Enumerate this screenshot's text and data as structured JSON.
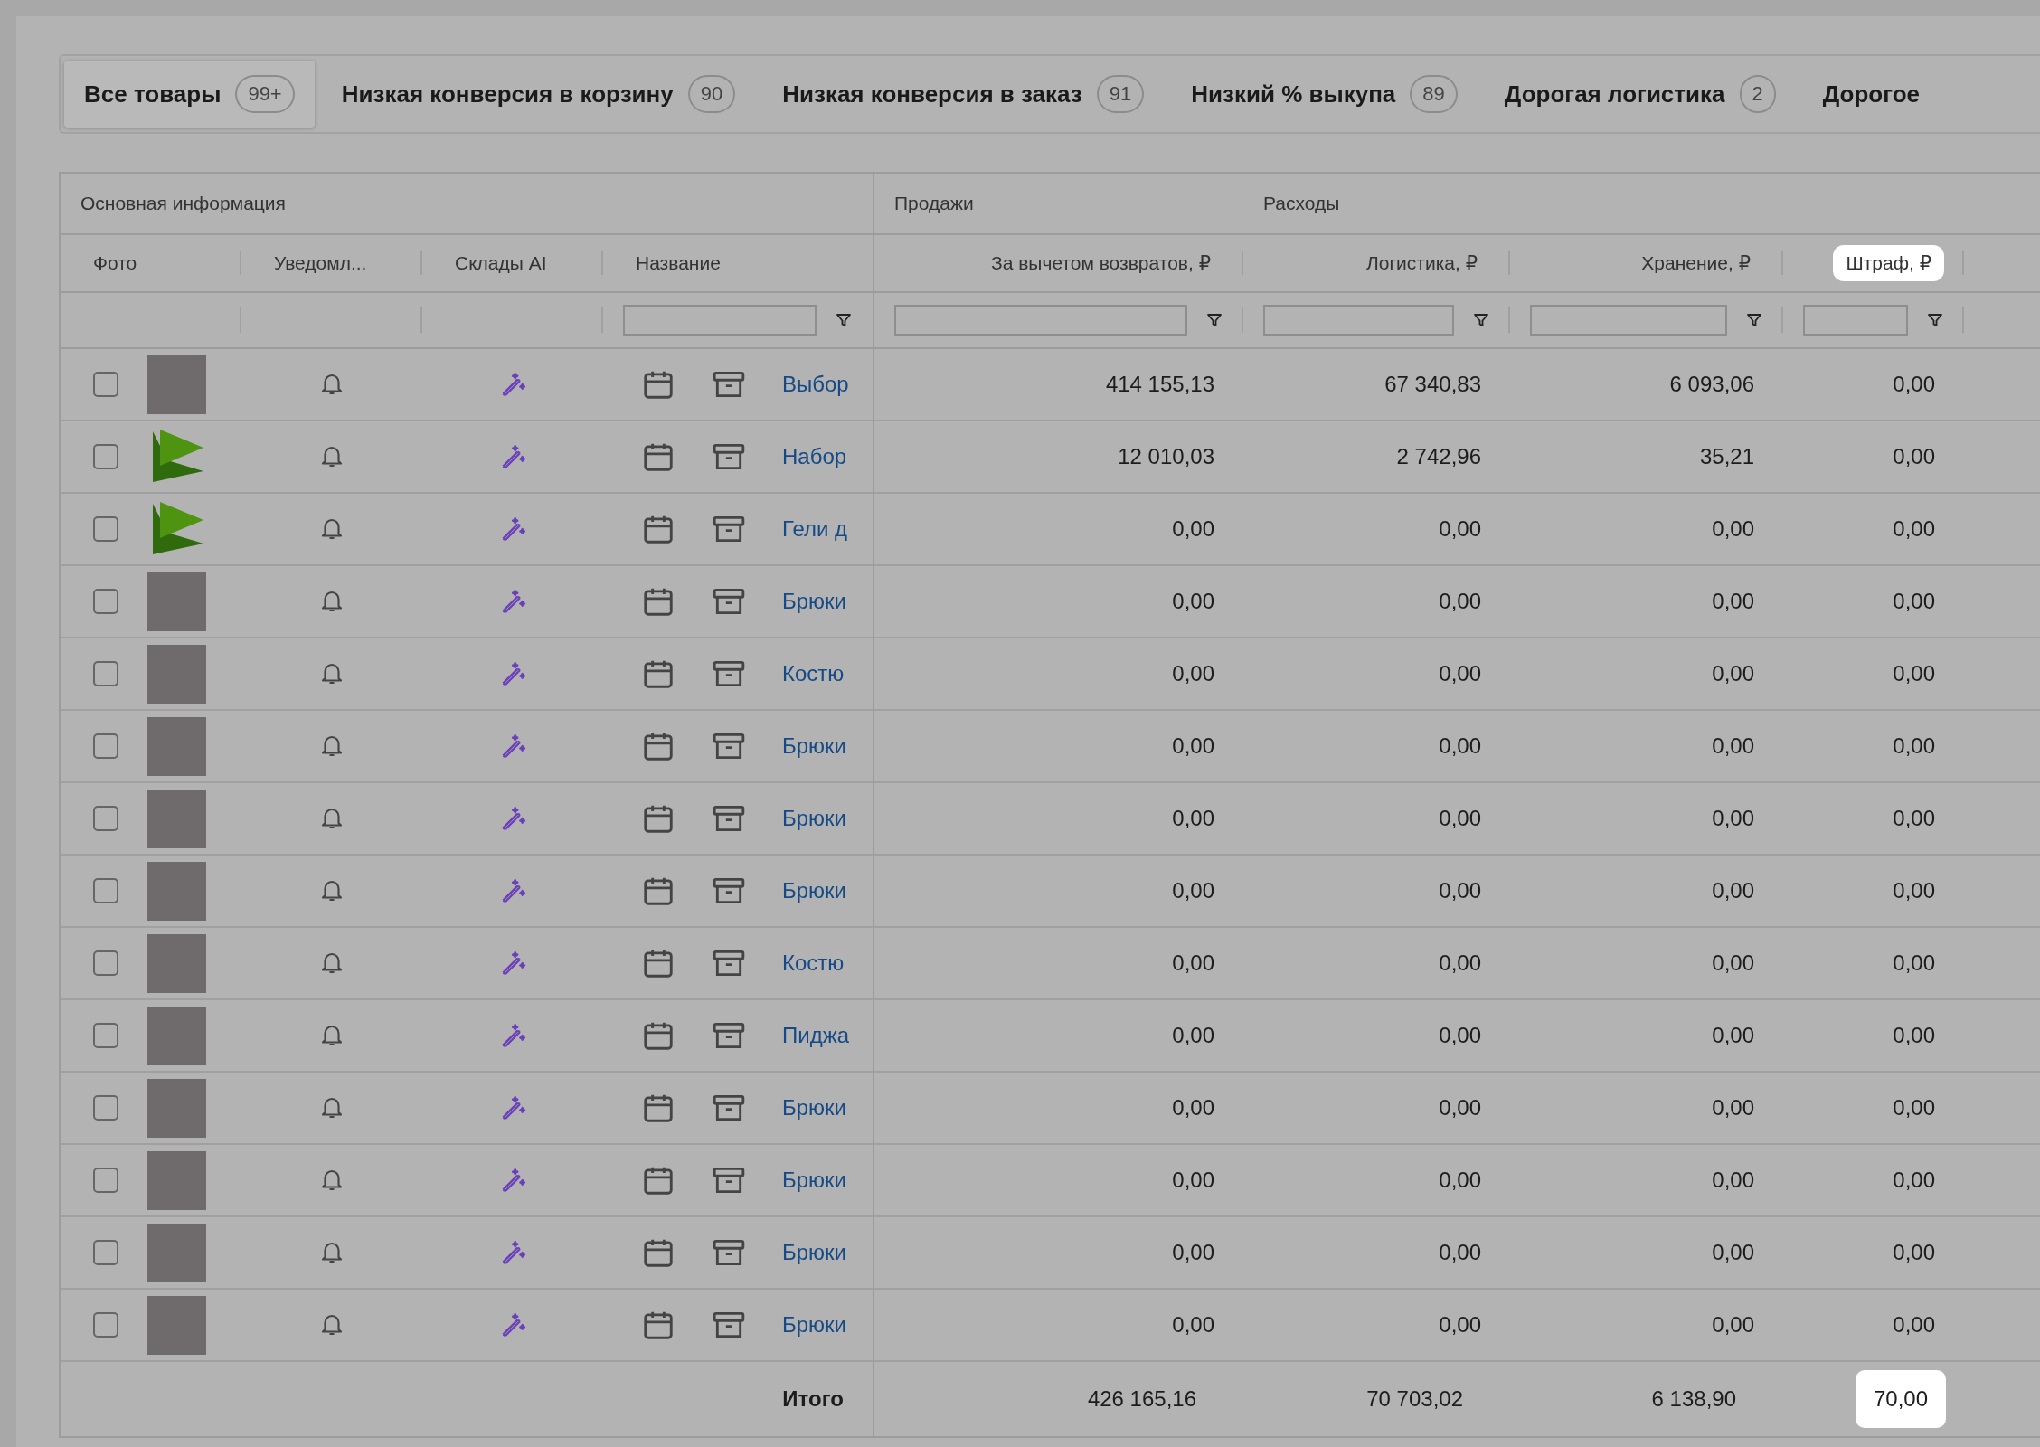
{
  "tabs": [
    {
      "label": "Все товары",
      "count": "99+",
      "selected": true
    },
    {
      "label": "Низкая конверсия в корзину",
      "count": "90",
      "selected": false
    },
    {
      "label": "Низкая конверсия в заказ",
      "count": "91",
      "selected": false
    },
    {
      "label": "Низкий % выкупа",
      "count": "89",
      "selected": false
    },
    {
      "label": "Дорогая логистика",
      "count": "2",
      "selected": false
    },
    {
      "label": "Дорогое",
      "selected": false
    }
  ],
  "table": {
    "groups": [
      {
        "label": "Основная информация"
      },
      {
        "label": "Продажи"
      },
      {
        "label": "Расходы"
      }
    ],
    "columns": [
      {
        "label": "Фото",
        "kind": "text",
        "filter": false,
        "highlighted": false
      },
      {
        "label": "Уведомл...",
        "kind": "text",
        "filter": false,
        "highlighted": false
      },
      {
        "label": "Склады AI",
        "kind": "text",
        "filter": false,
        "highlighted": false
      },
      {
        "label": "Название",
        "kind": "text",
        "filter": true,
        "highlighted": false
      },
      {
        "label": "За вычетом возвратов, ₽",
        "kind": "number",
        "filter": true,
        "highlighted": false
      },
      {
        "label": "Логистика, ₽",
        "kind": "number",
        "filter": true,
        "highlighted": false
      },
      {
        "label": "Хранение, ₽",
        "kind": "number",
        "filter": true,
        "highlighted": false
      },
      {
        "label": "Штраф, ₽",
        "kind": "number",
        "filter": true,
        "highlighted": true
      }
    ],
    "rows": [
      {
        "checked": false,
        "kind": "photo",
        "name": "Выбор",
        "values": [
          "414 155,13",
          "67 340,83",
          "6 093,06",
          "0,00"
        ]
      },
      {
        "checked": false,
        "kind": "logo",
        "name": "Набор",
        "values": [
          "12 010,03",
          "2 742,96",
          "35,21",
          "0,00"
        ]
      },
      {
        "checked": false,
        "kind": "logo",
        "name": "Гели д",
        "values": [
          "0,00",
          "0,00",
          "0,00",
          "0,00"
        ]
      },
      {
        "checked": false,
        "kind": "photo",
        "name": "Брюки",
        "values": [
          "0,00",
          "0,00",
          "0,00",
          "0,00"
        ]
      },
      {
        "checked": false,
        "kind": "photo",
        "name": "Костю",
        "values": [
          "0,00",
          "0,00",
          "0,00",
          "0,00"
        ]
      },
      {
        "checked": false,
        "kind": "photo",
        "name": "Брюки",
        "values": [
          "0,00",
          "0,00",
          "0,00",
          "0,00"
        ]
      },
      {
        "checked": false,
        "kind": "photo",
        "name": "Брюки",
        "values": [
          "0,00",
          "0,00",
          "0,00",
          "0,00"
        ]
      },
      {
        "checked": false,
        "kind": "photo",
        "name": "Брюки",
        "values": [
          "0,00",
          "0,00",
          "0,00",
          "0,00"
        ]
      },
      {
        "checked": false,
        "kind": "photo",
        "name": "Костю",
        "values": [
          "0,00",
          "0,00",
          "0,00",
          "0,00"
        ]
      },
      {
        "checked": false,
        "kind": "photo",
        "name": "Пиджа",
        "values": [
          "0,00",
          "0,00",
          "0,00",
          "0,00"
        ]
      },
      {
        "checked": false,
        "kind": "photo",
        "name": "Брюки",
        "values": [
          "0,00",
          "0,00",
          "0,00",
          "0,00"
        ]
      },
      {
        "checked": false,
        "kind": "photo",
        "name": "Брюки",
        "values": [
          "0,00",
          "0,00",
          "0,00",
          "0,00"
        ]
      },
      {
        "checked": false,
        "kind": "photo",
        "name": "Брюки",
        "values": [
          "0,00",
          "0,00",
          "0,00",
          "0,00"
        ]
      },
      {
        "checked": false,
        "kind": "photo",
        "name": "Брюки",
        "values": [
          "0,00",
          "0,00",
          "0,00",
          "0,00"
        ]
      }
    ],
    "total": {
      "label": "Итого",
      "values": [
        {
          "value": "426 165,16",
          "highlighted": false
        },
        {
          "value": "70 703,02",
          "highlighted": false
        },
        {
          "value": "6 138,90",
          "highlighted": false
        },
        {
          "value": "70,00",
          "highlighted": true
        }
      ]
    }
  }
}
